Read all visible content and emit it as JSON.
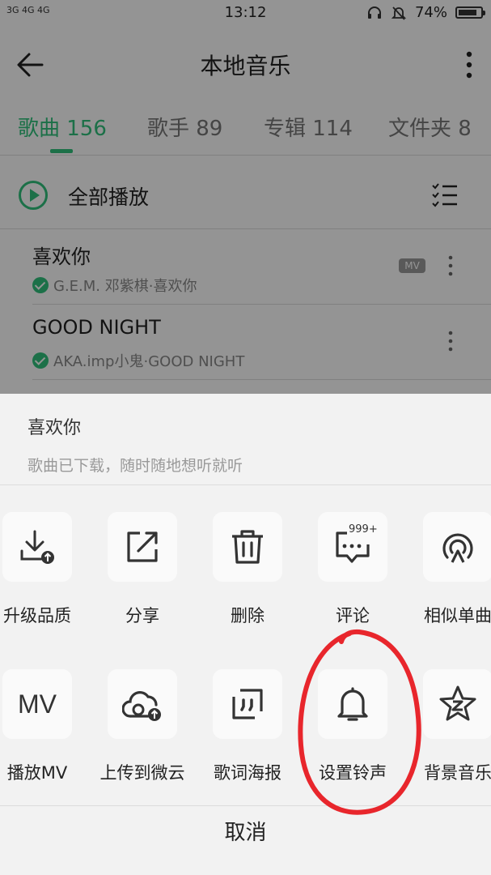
{
  "status_bar": {
    "signal_text": "3G 4G 4G",
    "time": "13:12",
    "battery": "74%"
  },
  "header": {
    "title": "本地音乐"
  },
  "tabs": [
    {
      "label": "歌曲 156",
      "active": true
    },
    {
      "label": "歌手 89",
      "active": false
    },
    {
      "label": "专辑 114",
      "active": false
    },
    {
      "label": "文件夹 8",
      "active": false
    }
  ],
  "play_all": {
    "label": "全部播放"
  },
  "songs": [
    {
      "title": "喜欢你",
      "subtitle": "G.E.M. 邓紫棋·喜欢你",
      "mv_badge": "MV"
    },
    {
      "title": "GOOD NIGHT",
      "subtitle": "AKA.imp小鬼·GOOD NIGHT"
    }
  ],
  "sheet": {
    "title": "喜欢你",
    "subtitle": "歌曲已下载，随时随地想听就听",
    "row1": [
      {
        "label": "升级品质",
        "icon": "download-upgrade-icon"
      },
      {
        "label": "分享",
        "icon": "share-icon"
      },
      {
        "label": "删除",
        "icon": "trash-icon"
      },
      {
        "label": "评论",
        "icon": "comment-icon",
        "badge": "999+"
      },
      {
        "label": "相似单曲",
        "icon": "radio-icon"
      }
    ],
    "row2": [
      {
        "label": "播放MV",
        "icon": "mv-icon",
        "icon_text": "MV"
      },
      {
        "label": "上传到微云",
        "icon": "cloud-upload-icon"
      },
      {
        "label": "歌词海报",
        "icon": "lyrics-poster-icon"
      },
      {
        "label": "设置铃声",
        "icon": "bell-icon"
      },
      {
        "label": "背景音乐",
        "icon": "star-z-icon"
      }
    ],
    "cancel": "取消"
  },
  "colors": {
    "accent": "#31c27c",
    "annotation": "#e8262c"
  }
}
